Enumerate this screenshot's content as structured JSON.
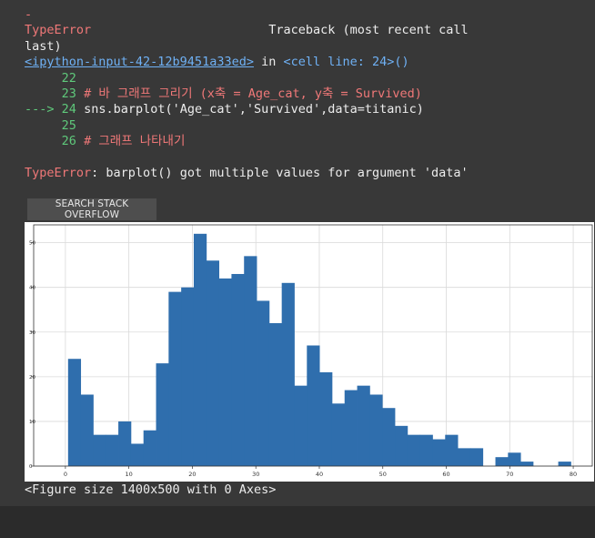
{
  "traceback": {
    "dash": "-",
    "error_type": "TypeError",
    "traceback_label": "Traceback (most recent call",
    "traceback_label_cont": "last)",
    "input_link": "<ipython-input-42-12b9451a33ed>",
    "in_word": " in ",
    "cell_ref": "<cell line: 24>()",
    "lines": [
      {
        "arrow": "    ",
        "num": "22",
        "code": ""
      },
      {
        "arrow": "    ",
        "num": "23",
        "code": "# 바 그래프 그리기 (x축 = Age_cat, y축 = Survived)"
      },
      {
        "arrow": "--->",
        "num": "24",
        "code": "sns.barplot('Age_cat','Survived',data=titanic)"
      },
      {
        "arrow": "    ",
        "num": "25",
        "code": ""
      },
      {
        "arrow": "    ",
        "num": "26",
        "code": "# 그래프 나타내기"
      }
    ],
    "final_error_type": "TypeError",
    "final_error_msg": ": barplot() got multiple values for argument 'data'"
  },
  "search_button_label": "SEARCH STACK OVERFLOW",
  "figure_caption": "<Figure size 1400x500 with 0 Axes>",
  "chart_data": {
    "type": "bar",
    "title": "",
    "xlabel": "",
    "ylabel": "",
    "xlim": [
      -5,
      83
    ],
    "ylim": [
      0,
      54
    ],
    "xticks": [
      0,
      10,
      20,
      30,
      40,
      50,
      60,
      70,
      80
    ],
    "yticks": [
      0,
      10,
      20,
      30,
      40,
      50
    ],
    "grid": true,
    "bar_color": "#2f6ead",
    "bin_edges": [
      0.42,
      2.4,
      4.38,
      6.36,
      8.34,
      10.32,
      12.3,
      14.28,
      16.26,
      18.24,
      20.22,
      22.2,
      24.18,
      26.16,
      28.14,
      30.12,
      32.1,
      34.08,
      36.06,
      38.04,
      40.02,
      42.0,
      43.98,
      45.96,
      47.94,
      49.92,
      51.9,
      53.88,
      55.86,
      57.84,
      59.82,
      61.8,
      63.78,
      65.76,
      67.74,
      69.72,
      71.7,
      73.68,
      75.66,
      77.64,
      79.62,
      81.6
    ],
    "values": [
      24,
      16,
      7,
      7,
      10,
      5,
      8,
      23,
      39,
      40,
      52,
      46,
      42,
      43,
      47,
      37,
      32,
      41,
      18,
      27,
      21,
      14,
      17,
      18,
      16,
      13,
      9,
      7,
      7,
      6,
      7,
      4,
      4,
      0,
      2,
      3,
      1,
      0,
      0,
      1,
      0
    ]
  }
}
